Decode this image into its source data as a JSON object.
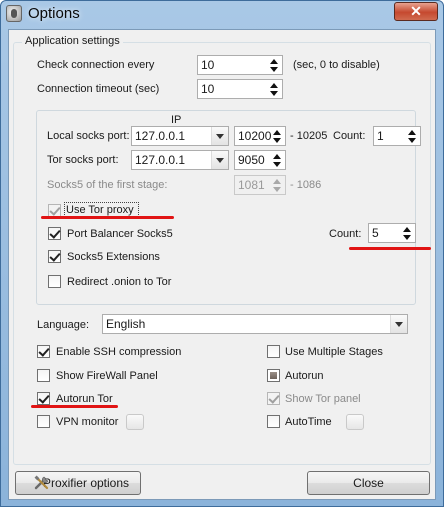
{
  "window": {
    "title": "Options",
    "close_glyph": "✕"
  },
  "application_settings": {
    "group_label": "Application settings",
    "check_connection_label": "Check connection every",
    "check_connection_value": "10",
    "check_connection_hint": "(sec, 0 to disable)",
    "connection_timeout_label": "Connection timeout (sec)",
    "connection_timeout_value": "10"
  },
  "proxy": {
    "ip_header": "IP",
    "local_socks_label": "Local socks port:",
    "local_socks_ip": "127.0.0.1",
    "local_socks_port": "10200",
    "local_socks_range": "- 10205",
    "local_count_label": "Count:",
    "local_count_value": "1",
    "tor_socks_label": "Tor socks port:",
    "tor_socks_ip": "127.0.0.1",
    "tor_socks_port": "9050",
    "socks5_first_stage_label": "Socks5 of the first stage:",
    "socks5_first_stage_port": "1081",
    "socks5_first_stage_range": "- 1086",
    "use_tor_proxy": {
      "label": "Use Tor proxy",
      "checked": true,
      "enabled": false
    },
    "port_balancer": {
      "label": "Port Balancer Socks5",
      "checked": true
    },
    "balancer_count_label": "Count:",
    "balancer_count_value": "5",
    "socks5_extensions": {
      "label": "Socks5 Extensions",
      "checked": true
    },
    "redirect_onion": {
      "label": "Redirect .onion to Tor",
      "checked": false
    }
  },
  "language": {
    "label": "Language:",
    "value": "English"
  },
  "options": {
    "enable_ssh": {
      "label": "Enable SSH compression",
      "checked": true
    },
    "use_multiple_stages": {
      "label": "Use Multiple Stages",
      "checked": false
    },
    "show_firewall": {
      "label": "Show FireWall Panel",
      "checked": false
    },
    "autorun": {
      "label": "Autorun",
      "state": "indeterminate"
    },
    "autorun_tor": {
      "label": "Autorun Tor",
      "checked": true
    },
    "show_tor_panel": {
      "label": "Show Tor panel",
      "checked": true,
      "enabled": false
    },
    "vpn_monitor": {
      "label": "VPN monitor",
      "checked": false
    },
    "autotime": {
      "label": "AutoTime",
      "checked": false
    }
  },
  "buttons": {
    "proxifier": "Proxifier options",
    "close": "Close"
  },
  "colors": {
    "highlight_underline": "#e11414",
    "title_gradient": "#a9c8e6"
  }
}
